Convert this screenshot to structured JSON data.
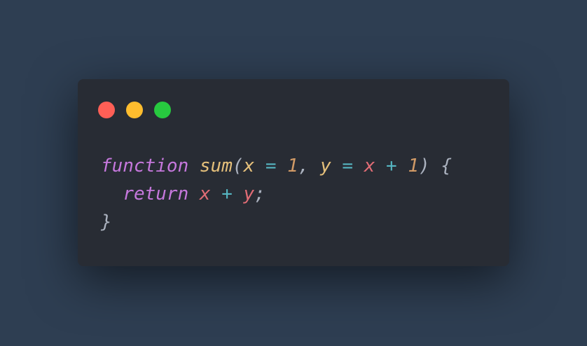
{
  "window": {
    "controls": [
      {
        "name": "close",
        "color": "#ff5f56"
      },
      {
        "name": "minimize",
        "color": "#ffbd2e"
      },
      {
        "name": "maximize",
        "color": "#27c93f"
      }
    ]
  },
  "colors": {
    "background": "#2e3e52",
    "window_bg": "#282c34",
    "keyword": "#c678dd",
    "function": "#e5c07b",
    "param": "#e5c07b",
    "variable": "#e06c75",
    "operator": "#56b6c2",
    "number": "#d19a66",
    "punctuation": "#abb2bf"
  },
  "code": {
    "lines": [
      [
        {
          "text": "function",
          "type": "keyword"
        },
        {
          "text": " ",
          "type": "space"
        },
        {
          "text": "sum",
          "type": "function"
        },
        {
          "text": "(",
          "type": "punctuation"
        },
        {
          "text": "x",
          "type": "param"
        },
        {
          "text": " ",
          "type": "space"
        },
        {
          "text": "=",
          "type": "operator"
        },
        {
          "text": " ",
          "type": "space"
        },
        {
          "text": "1",
          "type": "number"
        },
        {
          "text": ",",
          "type": "punctuation"
        },
        {
          "text": " ",
          "type": "space"
        },
        {
          "text": "y",
          "type": "param"
        },
        {
          "text": " ",
          "type": "space"
        },
        {
          "text": "=",
          "type": "operator"
        },
        {
          "text": " ",
          "type": "space"
        },
        {
          "text": "x",
          "type": "variable"
        },
        {
          "text": " ",
          "type": "space"
        },
        {
          "text": "+",
          "type": "operator"
        },
        {
          "text": " ",
          "type": "space"
        },
        {
          "text": "1",
          "type": "number"
        },
        {
          "text": ")",
          "type": "punctuation"
        },
        {
          "text": " ",
          "type": "space"
        },
        {
          "text": "{",
          "type": "punctuation"
        }
      ],
      [
        {
          "text": "  ",
          "type": "space"
        },
        {
          "text": "return",
          "type": "keyword"
        },
        {
          "text": " ",
          "type": "space"
        },
        {
          "text": "x",
          "type": "variable"
        },
        {
          "text": " ",
          "type": "space"
        },
        {
          "text": "+",
          "type": "operator"
        },
        {
          "text": " ",
          "type": "space"
        },
        {
          "text": "y",
          "type": "variable"
        },
        {
          "text": ";",
          "type": "punctuation"
        }
      ],
      [
        {
          "text": "}",
          "type": "punctuation"
        }
      ]
    ]
  }
}
